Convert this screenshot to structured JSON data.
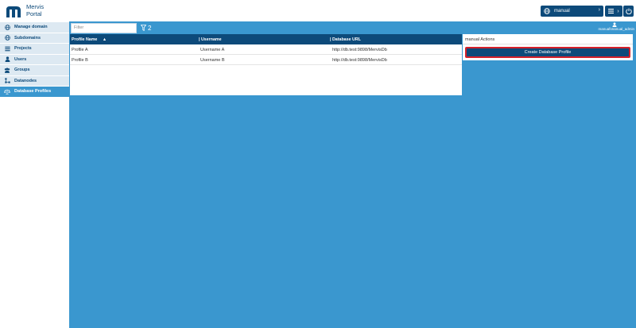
{
  "app": {
    "logo_line1": "Mervis",
    "logo_line2": "Portal",
    "brand_color": "#0d4a7a",
    "accent_color": "#3a97cf"
  },
  "header": {
    "domain_value": "manual",
    "domain_icon": "globe-icon",
    "menu_icon": "hamburger-icon",
    "power_icon": "power-icon"
  },
  "user": {
    "name": "manual\\manual_admin",
    "icon": "user-icon"
  },
  "sidebar": {
    "items": [
      {
        "label": "Manage domain",
        "icon": "globe-icon",
        "active": false
      },
      {
        "label": "Subdomains",
        "icon": "globe-icon",
        "active": false
      },
      {
        "label": "Projects",
        "icon": "list-icon",
        "active": false
      },
      {
        "label": "Users",
        "icon": "user-icon",
        "active": false
      },
      {
        "label": "Groups",
        "icon": "users-icon",
        "active": false
      },
      {
        "label": "Datanodes",
        "icon": "datanodes-icon",
        "active": false
      },
      {
        "label": "Database Profiles",
        "icon": "database-icon",
        "active": true
      }
    ]
  },
  "filter": {
    "placeholder": "Filter",
    "value": "",
    "count": "2",
    "icon": "filter-icon"
  },
  "table": {
    "columns": [
      {
        "label": "Profile Name",
        "sort": "asc"
      },
      {
        "label": "Username"
      },
      {
        "label": "Database URL"
      }
    ],
    "rows": [
      {
        "name": "Profile A",
        "username": "Username A",
        "url": "http://db.test:9898/MervisDb"
      },
      {
        "name": "Profile B",
        "username": "Username B",
        "url": "http://db.test:9898/MervisDb"
      }
    ]
  },
  "actions": {
    "title": "manual Actions",
    "create_label": "Create Database Profile"
  }
}
